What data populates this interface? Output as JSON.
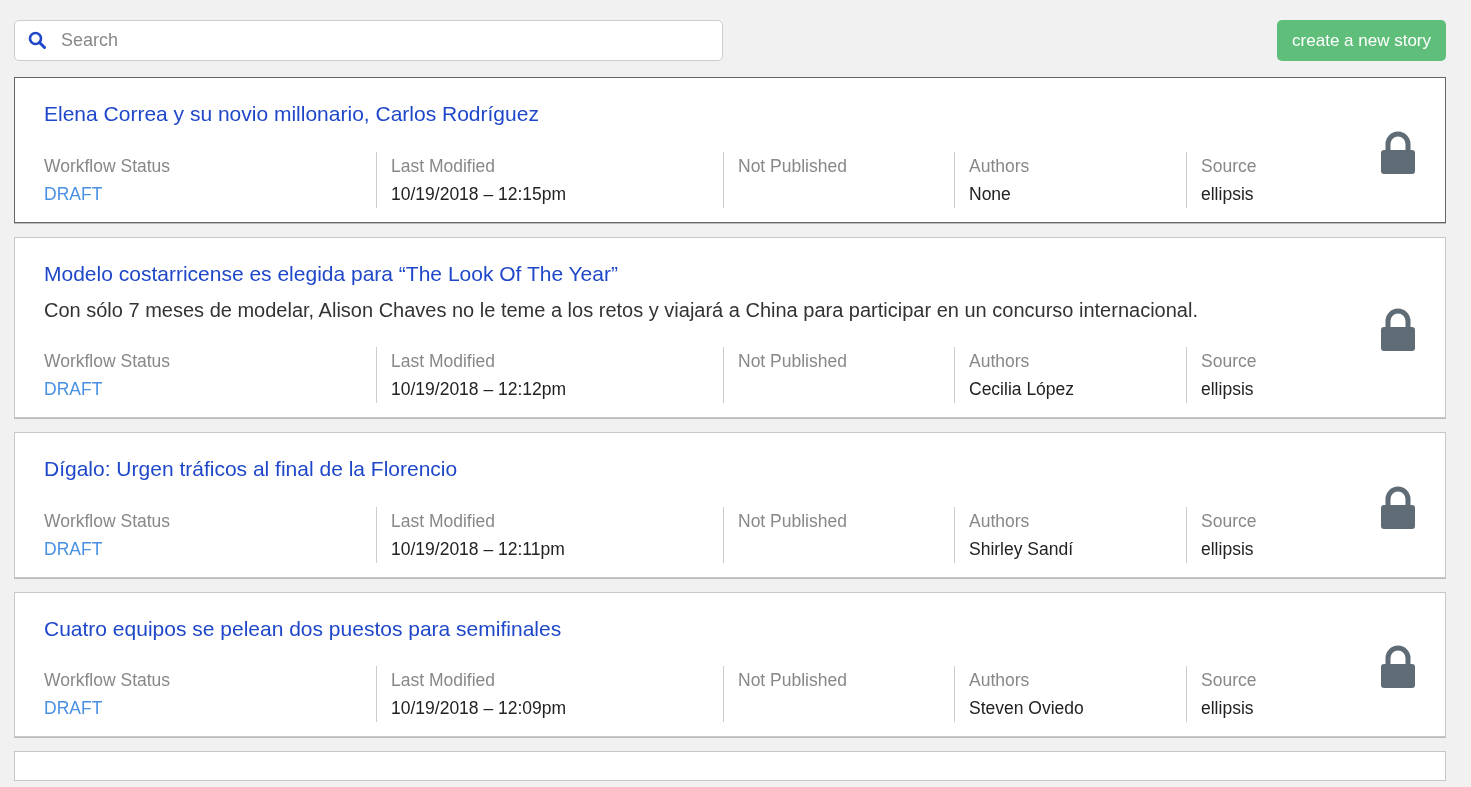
{
  "search": {
    "placeholder": "Search"
  },
  "create_button": "create a new story",
  "stories": [
    {
      "title": "Elena Correa y su novio millonario, Carlos Rodríguez",
      "selected": true,
      "locked": true,
      "fields": [
        {
          "kind": "status",
          "label": "Workflow Status",
          "value": "DRAFT"
        },
        {
          "kind": "text",
          "label": "Last Modified",
          "value": "10/19/2018 – 12:15pm"
        },
        {
          "kind": "text",
          "label": "Not Published"
        },
        {
          "kind": "text",
          "label": "Authors",
          "value": "None"
        },
        {
          "kind": "text",
          "label": "Source",
          "value": "ellipsis"
        }
      ]
    },
    {
      "title": "Modelo costarricense es elegida para “The Look Of The Year”",
      "summary": "Con sólo 7 meses de modelar, Alison Chaves no le teme a los retos y viajará a China para participar en un concurso internacional.",
      "selected": false,
      "locked": true,
      "fields": [
        {
          "kind": "status",
          "label": "Workflow Status",
          "value": "DRAFT"
        },
        {
          "kind": "text",
          "label": "Last Modified",
          "value": "10/19/2018 – 12:12pm"
        },
        {
          "kind": "text",
          "label": "Not Published"
        },
        {
          "kind": "text",
          "label": "Authors",
          "value": "Cecilia López"
        },
        {
          "kind": "text",
          "label": "Source",
          "value": "ellipsis"
        }
      ]
    },
    {
      "title": "Dígalo: Urgen tráficos al final de la Florencio",
      "selected": false,
      "locked": true,
      "fields": [
        {
          "kind": "status",
          "label": "Workflow Status",
          "value": "DRAFT"
        },
        {
          "kind": "text",
          "label": "Last Modified",
          "value": "10/19/2018 – 12:11pm"
        },
        {
          "kind": "text",
          "label": "Not Published"
        },
        {
          "kind": "text",
          "label": "Authors",
          "value": "Shirley Sandí"
        },
        {
          "kind": "text",
          "label": "Source",
          "value": "ellipsis"
        }
      ]
    },
    {
      "title": "Cuatro equipos se pelean dos puestos para semifinales",
      "selected": false,
      "locked": true,
      "fields": [
        {
          "kind": "status",
          "label": "Workflow Status",
          "value": "DRAFT"
        },
        {
          "kind": "text",
          "label": "Last Modified",
          "value": "10/19/2018 – 12:09pm"
        },
        {
          "kind": "text",
          "label": "Not Published"
        },
        {
          "kind": "text",
          "label": "Authors",
          "value": "Steven Oviedo"
        },
        {
          "kind": "text",
          "label": "Source",
          "value": "ellipsis"
        }
      ]
    }
  ]
}
